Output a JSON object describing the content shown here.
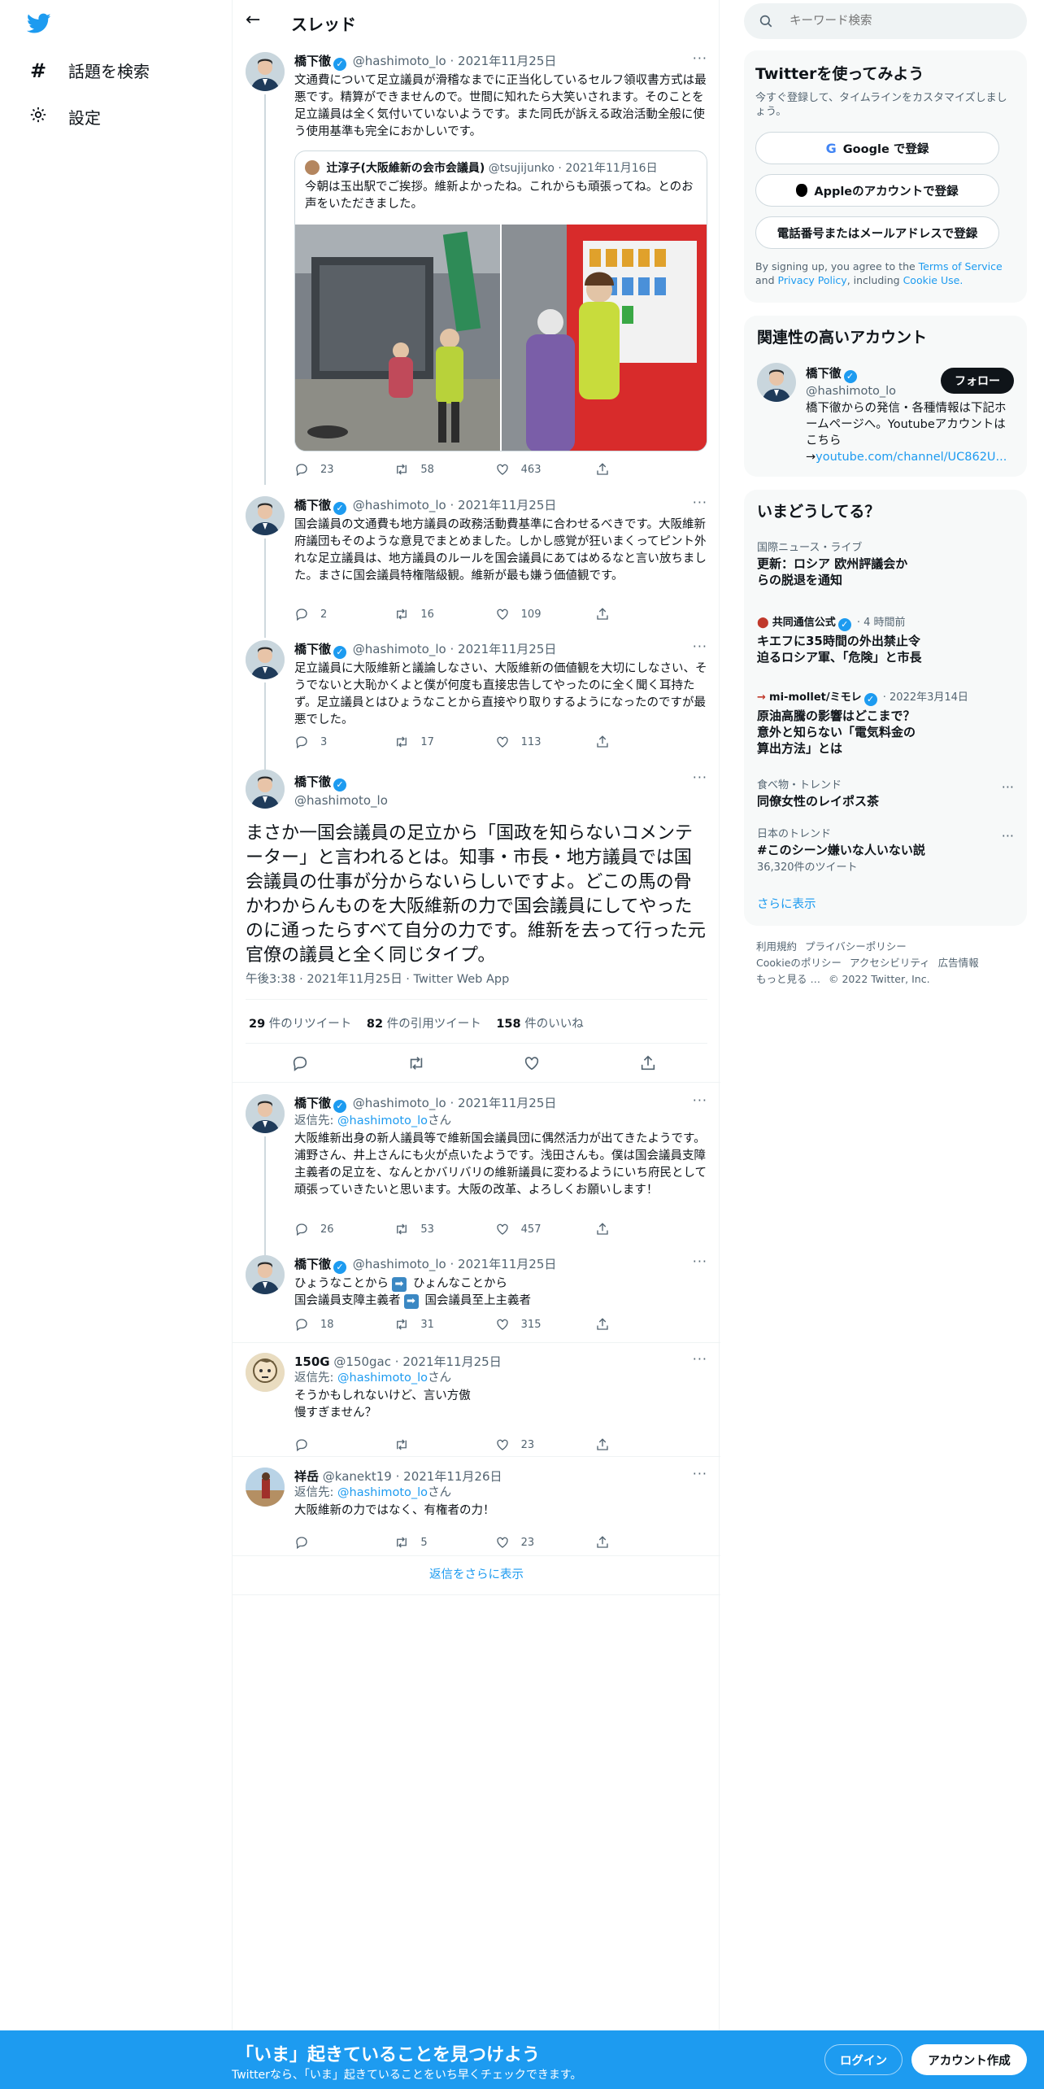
{
  "nav": {
    "explore": "話題を検索",
    "settings": "設定"
  },
  "header": {
    "title": "スレッド"
  },
  "tweets": [
    {
      "name": "橋下徹",
      "handle": "@hashimoto_lo",
      "date": "2021年11月25日",
      "text": "文通費について足立議員が滑稽なまでに正当化しているセルフ領収書方式は最悪です。精算ができませんので。世間に知れたら大笑いされます。そのことを足立議員は全く気付いていないようです。また同氏が訴える政治活動全般に使う使用基準も完全におかしいです。",
      "quote": {
        "name": "辻淳子(大阪維新の会市会議員)",
        "handle": "@tsujijunko",
        "date": "2021年11月16日",
        "text": "今朝は玉出駅でご挨拶。維新よかったね。これからも頑張ってね。とのお声をいただきました。"
      },
      "replies": "23",
      "retweets": "58",
      "likes": "463"
    },
    {
      "name": "橋下徹",
      "handle": "@hashimoto_lo",
      "date": "2021年11月25日",
      "text": "国会議員の文通費も地方議員の政務活動費基準に合わせるべきです。大阪維新府議団もそのような意見でまとめました。しかし感覚が狂いまくってピント外れな足立議員は、地方議員のルールを国会議員にあてはめるなと言い放ちました。まさに国会議員特権階級観。維新が最も嫌う価値観です。",
      "replies": "2",
      "retweets": "16",
      "likes": "109"
    },
    {
      "name": "橋下徹",
      "handle": "@hashimoto_lo",
      "date": "2021年11月25日",
      "text": "足立議員に大阪維新と議論しなさい、大阪維新の価値観を大切にしなさい、そうでないと大恥かくよと僕が何度も直接忠告してやったのに全く聞く耳持たず。足立議員とはひょうなことから直接やり取りするようになったのですが最悪でした。",
      "replies": "3",
      "retweets": "17",
      "likes": "113"
    }
  ],
  "main": {
    "name": "橋下徹",
    "handle": "@hashimoto_lo",
    "text": "まさか一国会議員の足立から「国政を知らないコメンテーター」と言われるとは。知事・市長・地方議員では国会議員の仕事が分からないらしいですよ。どこの馬の骨かわからんものを大阪維新の力で国会議員にしてやったのに通ったらすべて自分の力です。維新を去って行った元官僚の議員と全く同じタイプ。",
    "time": "午後3:38 · 2021年11月25日 · Twitter Web App",
    "retweets_num": "29",
    "retweets_label": "件のリツイート",
    "quotes_num": "82",
    "quotes_label": "件の引用ツイート",
    "likes_num": "158",
    "likes_label": "件のいいね"
  },
  "reply_to_label": "返信先:",
  "reply_to_handle": "@hashimoto_lo",
  "reply_to_suffix": "さん",
  "replies": [
    {
      "name": "橋下徹",
      "handle": "@hashimoto_lo",
      "date": "2021年11月25日",
      "text": "大阪維新出身の新人議員等で維新国会議員団に偶然活力が出てきたようです。浦野さん、井上さんにも火が点いたようです。浅田さんも。僕は国会議員支障主義者の足立を、なんとかバリバリの維新議員に変わるようにいち府民として頑張っていきたいと思います。大阪の改革、よろしくお願いします！",
      "replies": "26",
      "retweets": "53",
      "likes": "457"
    },
    {
      "name": "橋下徹",
      "handle": "@hashimoto_lo",
      "date": "2021年11月25日",
      "line1a": "ひょうなことから",
      "line1b": "ひょんなことから",
      "line2a": "国会議員支障主義者",
      "line2b": "国会議員至上主義者",
      "replies": "18",
      "retweets": "31",
      "likes": "315"
    },
    {
      "name": "150G",
      "handle": "@150gac",
      "date": "2021年11月25日",
      "text": "そうかもしれないけど、言い方傲慢すぎません？",
      "replies": "",
      "retweets": "",
      "likes": "23"
    },
    {
      "name": "祥岳",
      "handle": "@kanekt19",
      "date": "2021年11月26日",
      "text": "大阪維新の力ではなく、有権者の力！",
      "replies": "",
      "retweets": "5",
      "likes": "23"
    }
  ],
  "show_more": "返信をさらに表示",
  "search": {
    "placeholder": "キーワード検索"
  },
  "signup": {
    "title": "Twitterを使ってみよう",
    "subtitle": "今すぐ登録して、タイムラインをカスタマイズしましょう。",
    "google": "Google で登録",
    "apple": "Appleのアカウントで登録",
    "phone": "電話番号またはメールアドレスで登録",
    "legal_a": "By signing up, you agree to the",
    "terms": "Terms of Service",
    "and": "and",
    "privacy": "Privacy Policy",
    "including": ", including",
    "cookie": "Cookie Use."
  },
  "related": {
    "title": "関連性の高いアカウント",
    "name": "橋下徹",
    "handle": "@hashimoto_lo",
    "follow": "フォロー",
    "bio": "橋下徹からの発信・各種情報は下記ホームページへ。Youtubeアカウントはこちら →",
    "link": "youtube.com/channel/UC862U..."
  },
  "trends": {
    "title": "いまどうしてる？",
    "items": [
      {
        "category": "国際ニュース・ライブ",
        "title": "更新：ロシア 欧州評議会からの脱退を通知"
      },
      {
        "source": "共同通信公式",
        "time": "4 時間前",
        "title": "キエフに35時間の外出禁止令　迫るロシア軍、「危険」と市長"
      },
      {
        "source": "mi-mollet/ミモレ",
        "time": "2022年3月14日",
        "title": "原油高騰の影響はどこまで？意外と知らない「電気料金の算出方法」とは"
      },
      {
        "category": "食べ物・トレンド",
        "title": "同僚女性のレイポス茶"
      },
      {
        "category": "日本のトレンド",
        "title": "#このシーン嫌いな人いない説",
        "count": "36,320件のツイート"
      }
    ],
    "show_more": "さらに表示"
  },
  "footer": {
    "terms": "利用規約",
    "privacy": "プライバシーポリシー",
    "cookie": "Cookieのポリシー",
    "accessibility": "アクセシビリティ",
    "ads": "広告情報",
    "more": "もっと見る …",
    "copyright": "© 2022 Twitter, Inc."
  },
  "bottom": {
    "title": "「いま」起きていることを見つけよう",
    "subtitle": "Twitterなら、「いま」起きていることをいち早くチェックできます。",
    "login": "ログイン",
    "signup": "アカウント作成"
  },
  "colors": {
    "accent": "#1d9bf0",
    "text": "#0f1419",
    "muted": "#536471"
  }
}
